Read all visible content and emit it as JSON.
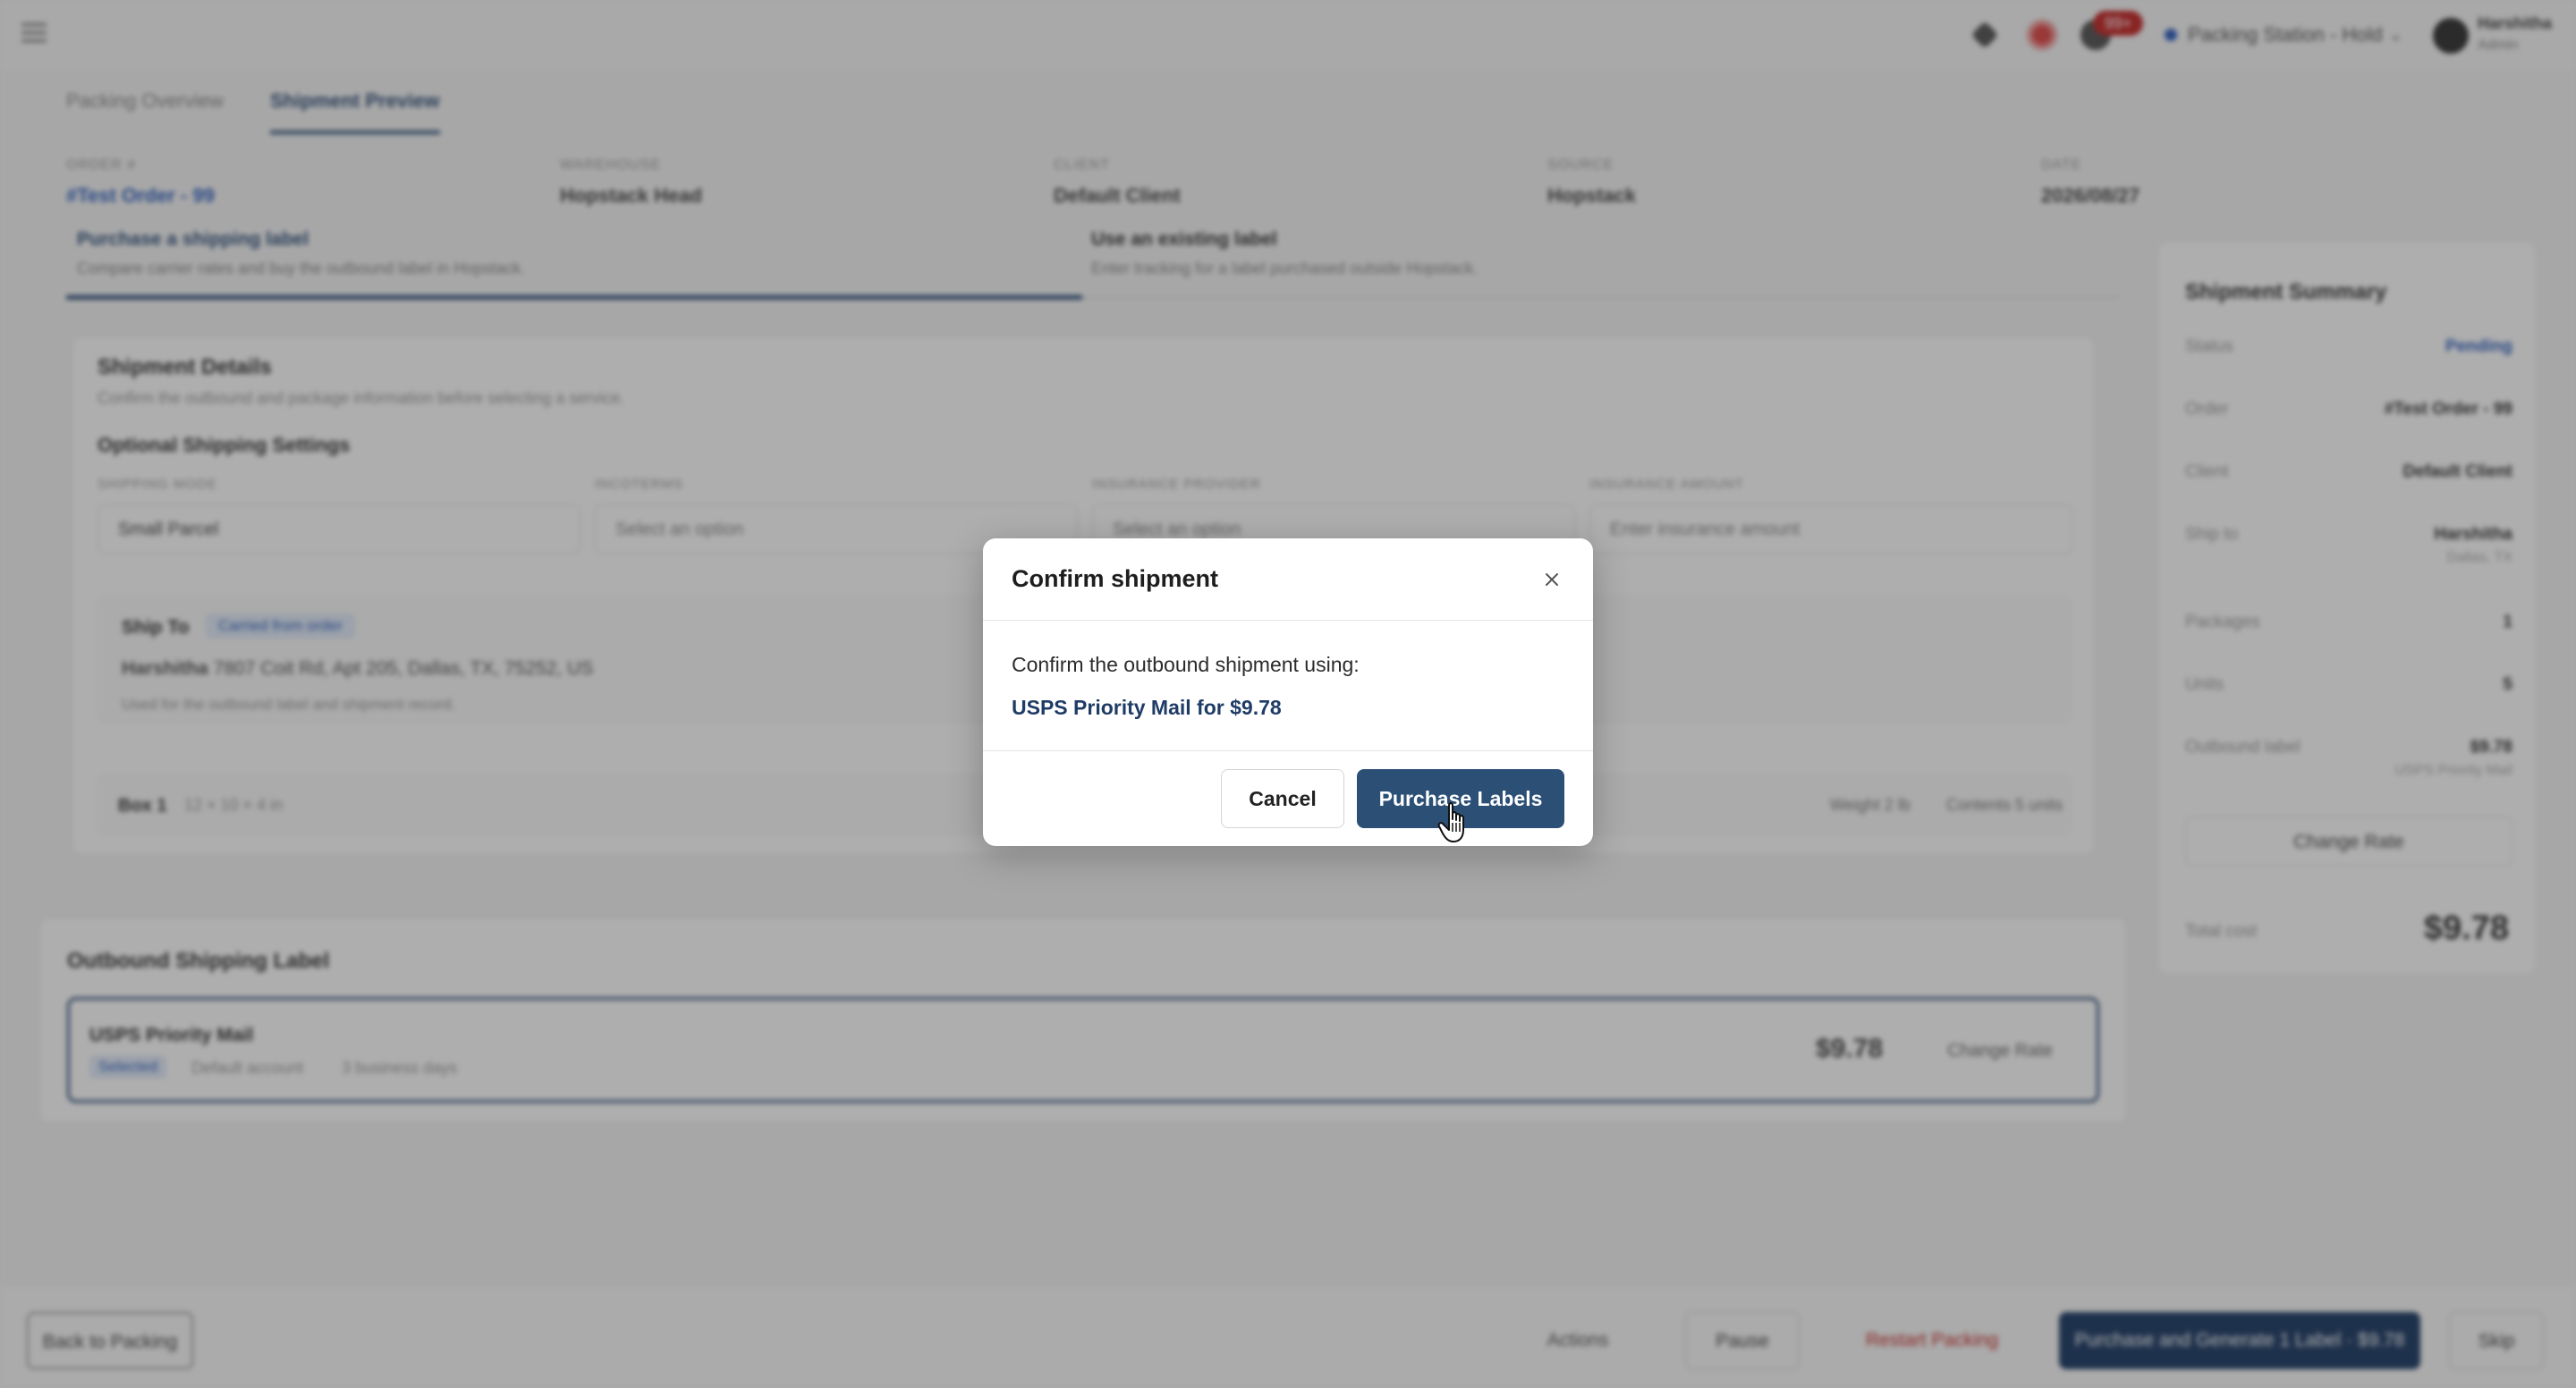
{
  "header": {
    "menu_icon": "hamburger-menu-icon",
    "notification_count": "99+",
    "station_label": "Packing Station - Hold",
    "user_name": "Harshitha",
    "user_role": "Admin"
  },
  "tabs": [
    {
      "label": "Packing Overview",
      "active": false
    },
    {
      "label": "Shipment Preview",
      "active": true
    }
  ],
  "order_meta": [
    {
      "key": "Order #",
      "value": "#Test Order - 99"
    },
    {
      "key": "Warehouse",
      "value": "Hopstack Head"
    },
    {
      "key": "Client",
      "value": "Default Client"
    },
    {
      "key": "Source",
      "value": "Hopstack"
    },
    {
      "key": "Date",
      "value": "2026/08/27"
    }
  ],
  "label_modes": [
    {
      "title": "Purchase a shipping label",
      "subtitle": "Compare carrier rates and buy the outbound label in Hopstack.",
      "active": true
    },
    {
      "title": "Use an existing label",
      "subtitle": "Enter tracking for a label purchased outside Hopstack.",
      "active": false
    }
  ],
  "shipment_details": {
    "title": "Shipment Details",
    "subtitle": "Confirm the outbound and package information before selecting a service.",
    "optional_title": "Optional Shipping Settings",
    "fields": [
      {
        "label": "Shipping Mode",
        "value": "Small Parcel"
      },
      {
        "label": "Incoterms",
        "value": "Select an option"
      },
      {
        "label": "Insurance Provider",
        "value": "Select an option"
      },
      {
        "label": "Insurance Amount",
        "value": "Enter insurance amount"
      }
    ],
    "ship_to": {
      "heading": "Ship To",
      "badge": "Carried from order",
      "address_name": "Harshitha",
      "address": "7807 Coit Rd, Apt 205, Dallas, TX, 75252, US",
      "note": "Used for the outbound label and shipment record."
    },
    "box": {
      "label": "Box 1",
      "dims": "12 × 10 × 4 in",
      "weight": "Weight 2 lb",
      "contents": "Contents 5 units"
    }
  },
  "summary": {
    "title": "Shipment Summary",
    "rows": [
      {
        "key": "Status",
        "value": "Pending"
      },
      {
        "key": "Order",
        "value": "#Test Order - 99"
      },
      {
        "key": "Client",
        "value": "Default Client"
      },
      {
        "key": "Ship to",
        "value": "Harshitha",
        "sub": "Dallas, TX"
      },
      {
        "key": "Packages",
        "value": "1"
      },
      {
        "key": "Units",
        "value": "5"
      },
      {
        "key": "Outbound label",
        "value": "$9.78",
        "sub": "USPS Priority Mail"
      }
    ],
    "change_rate": "Change Rate",
    "total_label": "Total cost",
    "total_value": "$9.78"
  },
  "outbound": {
    "title": "Outbound Shipping Label",
    "service": "USPS Priority Mail",
    "tag": "Selected",
    "account": "Default account",
    "days": "3 business days",
    "price": "$9.78",
    "change_rate": "Change Rate"
  },
  "bottom_bar": {
    "back": "Back to Packing",
    "actions": "Actions",
    "pause": "Pause",
    "restart": "Restart Packing",
    "primary": "Purchase and Generate 1 Label · $9.78",
    "skip": "Skip"
  },
  "modal": {
    "title": "Confirm shipment",
    "body": "Confirm the outbound shipment using:",
    "service_line": "USPS Priority Mail for $9.78",
    "cancel": "Cancel",
    "purchase": "Purchase Labels",
    "close_icon": "close-icon"
  },
  "colors": {
    "primary": "#2c4f76",
    "link": "#1f3c66",
    "danger": "#c62828"
  }
}
